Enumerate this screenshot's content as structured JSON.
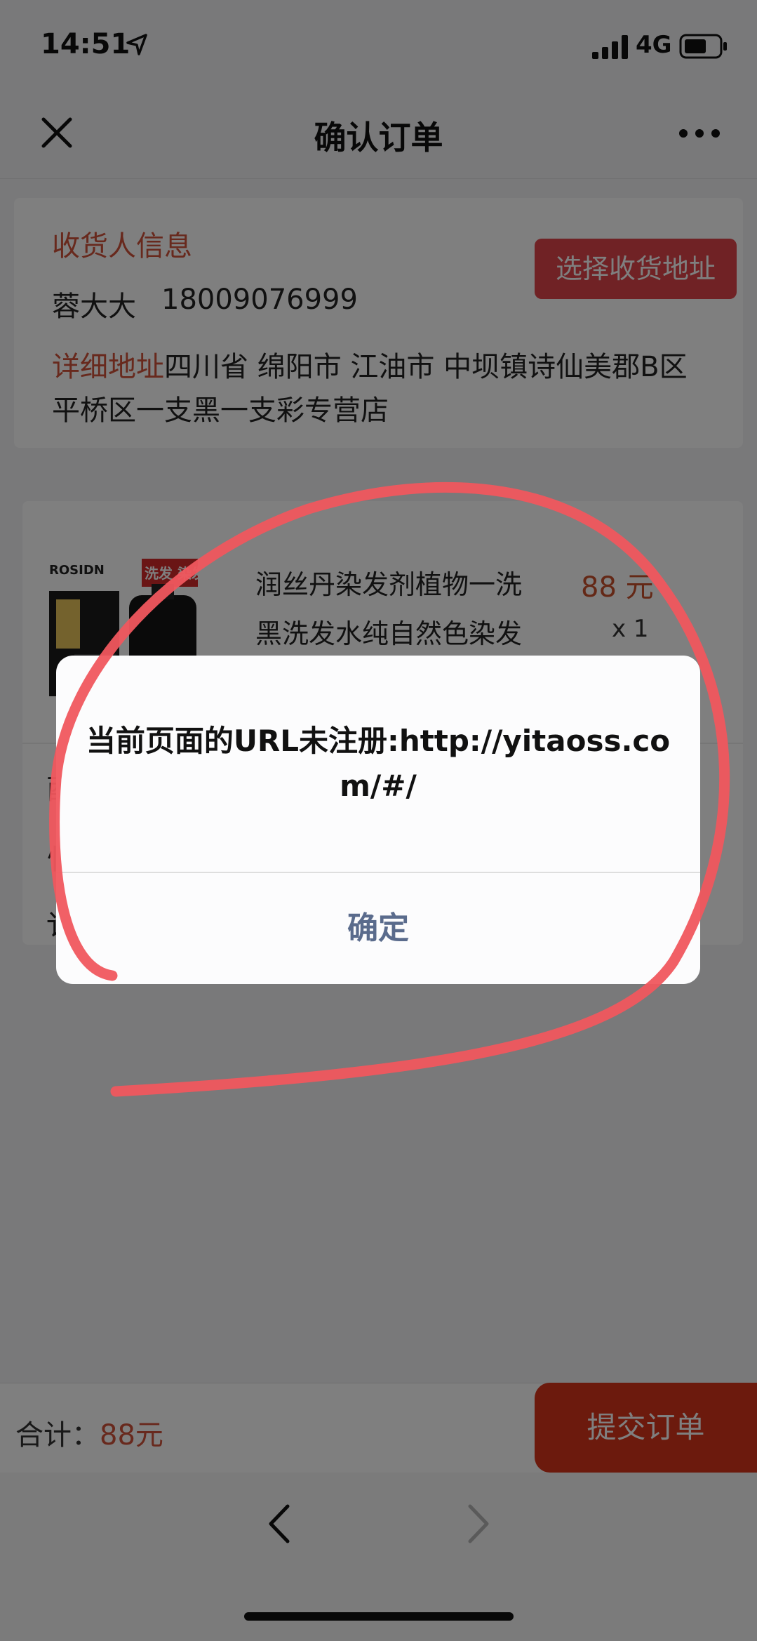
{
  "status_bar": {
    "time": "14:51",
    "network": "4G"
  },
  "nav": {
    "title": "确认订单"
  },
  "address": {
    "section_title": "收货人信息",
    "select_button": "选择收货地址",
    "name": "蓉大大",
    "phone": "18009076999",
    "detail_label": "详细地址",
    "detail_line1": "四川省 绵阳市 江油市 中坝镇诗仙美郡B区",
    "detail_line2": "平桥区一支黑一支彩专营店"
  },
  "product": {
    "title_line1": "润丝丹染发剂植物一洗",
    "title_line2": "黑洗发水纯自然色染发",
    "price": "88 元",
    "quantity": "x 1",
    "image_brand": "ROSIDN",
    "image_banner": "洗发 染发"
  },
  "order_rows": {
    "row1": "酉",
    "row2": "忄",
    "row3": "讠"
  },
  "footer": {
    "total_label": "合计：",
    "total_value": "88元",
    "submit_label": "提交订单"
  },
  "dialog": {
    "message": "当前页面的URL未注册:http://yitaoss.com/#/",
    "confirm_label": "确定"
  }
}
